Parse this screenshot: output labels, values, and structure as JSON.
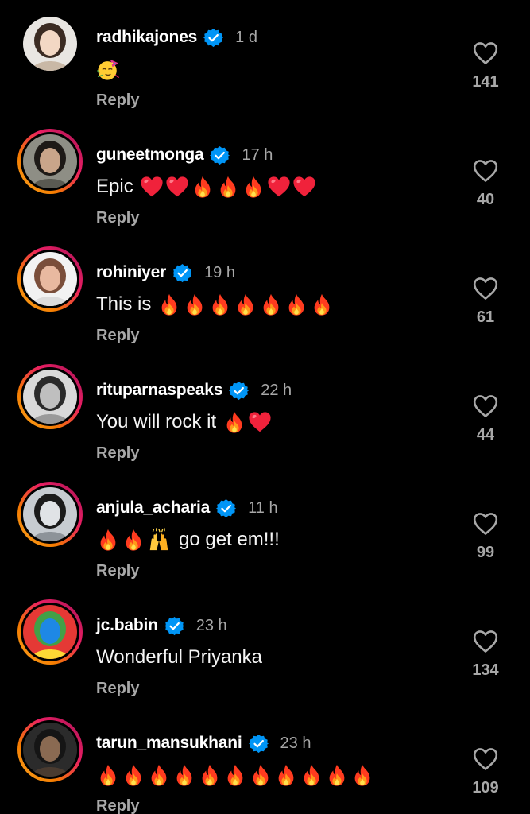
{
  "comments": [
    {
      "username": "radhikajones",
      "time": "1 d",
      "text": "",
      "emojis": [
        "partying-face-emoji"
      ],
      "reply_label": "Reply",
      "likes": "141",
      "avatar_ring": false,
      "avatar_palette": [
        "#e9e6e2",
        "#c9b8a6",
        "#3b2b22",
        "#f3d8c4"
      ]
    },
    {
      "username": "guneetmonga",
      "time": "17 h",
      "text": "Epic",
      "emojis": [
        "red-heart-emoji",
        "red-heart-emoji",
        "fire-emoji",
        "fire-emoji",
        "fire-emoji",
        "red-heart-emoji",
        "red-heart-emoji"
      ],
      "reply_label": "Reply",
      "likes": "40",
      "avatar_ring": true,
      "avatar_palette": [
        "#8e8e85",
        "#5a5a52",
        "#1e1a17",
        "#c9a58a"
      ]
    },
    {
      "username": "rohiniyer",
      "time": "19 h",
      "text": "This is",
      "emojis": [
        "fire-emoji",
        "fire-emoji",
        "fire-emoji",
        "fire-emoji",
        "fire-emoji",
        "fire-emoji",
        "fire-emoji"
      ],
      "reply_label": "Reply",
      "likes": "61",
      "avatar_ring": true,
      "avatar_palette": [
        "#f2f2f2",
        "#dcdcdc",
        "#7a4e3a",
        "#e8b9a0"
      ]
    },
    {
      "username": "rituparnaspeaks",
      "time": "22 h",
      "text": "You will rock it",
      "emojis": [
        "fire-emoji",
        "red-heart-emoji"
      ],
      "reply_label": "Reply",
      "likes": "44",
      "avatar_ring": true,
      "avatar_palette": [
        "#d9d9d9",
        "#9a9a9a",
        "#2a2a2a",
        "#bfbfbf"
      ]
    },
    {
      "username": "anjula_acharia",
      "time": "11 h",
      "text": "go get em!!!",
      "emojis": [
        "fire-emoji",
        "fire-emoji",
        "raising-hands-emoji"
      ],
      "reply_label": "Reply",
      "likes": "99",
      "avatar_ring": true,
      "avatar_palette": [
        "#c7ccd1",
        "#8d9399",
        "#1b1b1b",
        "#e0e3e6"
      ]
    },
    {
      "username": "jc.babin",
      "time": "23 h",
      "text": "Wonderful Priyanka",
      "emojis": [],
      "reply_label": "Reply",
      "likes": "134",
      "avatar_ring": true,
      "avatar_palette": [
        "#e53935",
        "#fdd835",
        "#43a047",
        "#1e88e5"
      ]
    },
    {
      "username": "tarun_mansukhani",
      "time": "23 h",
      "text": "",
      "emojis": [
        "fire-emoji",
        "fire-emoji",
        "fire-emoji",
        "fire-emoji",
        "fire-emoji",
        "fire-emoji",
        "fire-emoji",
        "fire-emoji",
        "fire-emoji",
        "fire-emoji",
        "fire-emoji"
      ],
      "reply_label": "Reply",
      "likes": "109",
      "avatar_ring": true,
      "avatar_palette": [
        "#2b2b2b",
        "#4a3b30",
        "#151515",
        "#8a6a52"
      ]
    }
  ],
  "colors": {
    "background": "#000000",
    "username": "#ffffff",
    "secondary_text": "#a8a8a8",
    "verified_badge": "#0095f6",
    "heart_outline": "#a8a8a8"
  }
}
